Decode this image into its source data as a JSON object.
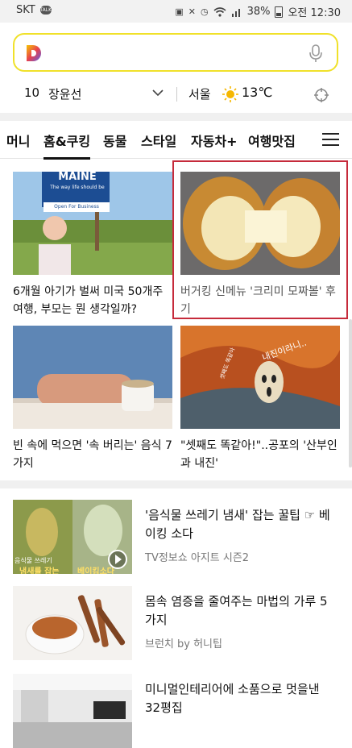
{
  "status": {
    "carrier": "SKT",
    "chat_badge": "TALK",
    "battery": "38%",
    "time": "오전 12:30"
  },
  "search": {
    "placeholder": ""
  },
  "info": {
    "bus_number": "10",
    "bus_stop": "장윤선",
    "city": "서울",
    "temperature": "13℃"
  },
  "tabs": [
    {
      "label": "머니"
    },
    {
      "label": "홈&쿠킹",
      "active": true
    },
    {
      "label": "동물"
    },
    {
      "label": "스타일"
    },
    {
      "label": "자동차+"
    },
    {
      "label": "여행맛집"
    }
  ],
  "cards": [
    {
      "title": "6개월 아기가 벌써 미국 50개주 여행, 부모는 뭔 생각일까?",
      "image_text": [
        "MAINE",
        "The way life should be",
        "Open For Business"
      ]
    },
    {
      "title": "버거킹 신메뉴 '크리미 모짜볼' 후기",
      "highlighted": true
    },
    {
      "title": "빈 속에 먹으면 '속 버리는' 음식 7가지"
    },
    {
      "title": "\"셋째도 똑같아!\"..공포의 '산부인과 내진'",
      "image_text": [
        "내진이라니..",
        "셋째도 똑같아"
      ]
    }
  ],
  "list": [
    {
      "title": "'음식물 쓰레기 냄새' 잡는 꿀팁 ☞ 베이킹 소다",
      "source": "TV정보쇼 아지트 시즌2",
      "image_text": [
        "음식물 쓰레기",
        "냄새를 잡는",
        "베이킹소다"
      ],
      "video": true
    },
    {
      "title": "몸속 염증을 줄여주는 마법의 가루 5가지",
      "source": "브런치 by 허니팁"
    },
    {
      "title": "미니멀인테리어에 소품으로 멋을낸 32평집",
      "source": ""
    }
  ]
}
